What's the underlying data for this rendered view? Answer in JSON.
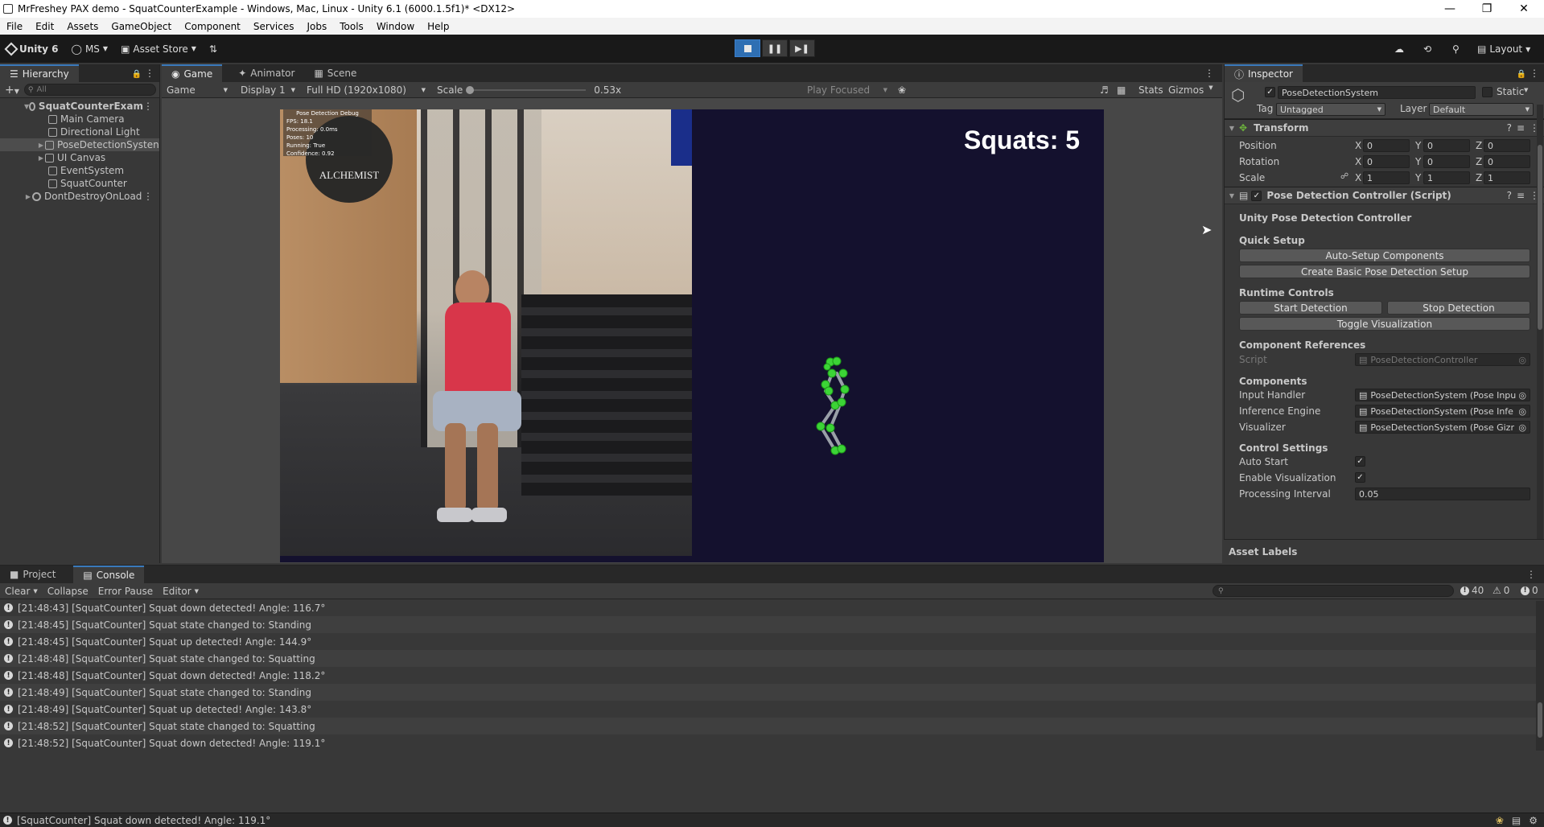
{
  "window": {
    "title": "MrFreshey PAX demo - SquatCounterExample - Windows, Mac, Linux - Unity 6.1 (6000.1.5f1)* <DX12>"
  },
  "menu": [
    "File",
    "Edit",
    "Assets",
    "GameObject",
    "Component",
    "Services",
    "Jobs",
    "Tools",
    "Window",
    "Help"
  ],
  "toolbar": {
    "unity_label": "Unity 6",
    "account_label": "MS",
    "asset_store_label": "Asset Store",
    "layout_label": "Layout"
  },
  "hierarchy": {
    "tab_label": "Hierarchy",
    "search_placeholder": "All",
    "items": [
      {
        "label": "SquatCounterExam",
        "level": 0
      },
      {
        "label": "Main Camera",
        "level": 1
      },
      {
        "label": "Directional Light",
        "level": 1
      },
      {
        "label": "PoseDetectionSysten",
        "level": 1
      },
      {
        "label": "UI Canvas",
        "level": 1
      },
      {
        "label": "EventSystem",
        "level": 1
      },
      {
        "label": "SquatCounter",
        "level": 1
      },
      {
        "label": "DontDestroyOnLoad",
        "level": 0
      }
    ]
  },
  "game": {
    "tabs": [
      "Game",
      "Animator",
      "Scene"
    ],
    "display_mode": "Game",
    "display": "Display 1",
    "resolution": "Full HD (1920x1080)",
    "scale_label": "Scale",
    "scale_value": "0.53x",
    "play_mode": "Play Focused",
    "stats_label": "Stats",
    "gizmos_label": "Gizmos",
    "squats_text": "Squats: 5",
    "debug": {
      "title": "Pose Detection Debug",
      "lines": [
        "FPS: 18.1",
        "Processing: 0.0ms",
        "Poses: 10",
        "Running: True",
        "Confidence: 0.92"
      ]
    },
    "logo_text": "ALCHEMIST"
  },
  "inspector": {
    "tab_label": "Inspector",
    "object_name": "PoseDetectionSystem",
    "static_label": "Static",
    "tag_label": "Tag",
    "tag_value": "Untagged",
    "layer_label": "Layer",
    "layer_value": "Default",
    "transform": {
      "title": "Transform",
      "rows": [
        {
          "label": "Position",
          "x": "0",
          "y": "0",
          "z": "0"
        },
        {
          "label": "Rotation",
          "x": "0",
          "y": "0",
          "z": "0"
        },
        {
          "label": "Scale",
          "x": "1",
          "y": "1",
          "z": "1"
        }
      ]
    },
    "component": {
      "title": "Pose Detection Controller (Script)",
      "heading": "Unity Pose Detection Controller",
      "quick_setup": "Quick Setup",
      "btn_auto_setup": "Auto-Setup Components",
      "btn_create_basic": "Create Basic Pose Detection Setup",
      "runtime_controls": "Runtime Controls",
      "btn_start": "Start Detection",
      "btn_stop": "Stop Detection",
      "btn_toggle": "Toggle Visualization",
      "component_refs": "Component References",
      "script_label": "Script",
      "script_value": "PoseDetectionController",
      "components": "Components",
      "input_handler_label": "Input Handler",
      "input_handler_value": "PoseDetectionSystem (Pose Inpu",
      "inference_label": "Inference Engine",
      "inference_value": "PoseDetectionSystem (Pose Infe",
      "visualizer_label": "Visualizer",
      "visualizer_value": "PoseDetectionSystem (Pose Gizr",
      "control_settings": "Control Settings",
      "auto_start_label": "Auto Start",
      "enable_vis_label": "Enable Visualization",
      "proc_interval_label": "Processing Interval",
      "proc_interval_value": "0.05"
    },
    "asset_labels": "Asset Labels"
  },
  "console": {
    "tabs": [
      "Project",
      "Console"
    ],
    "clear_label": "Clear",
    "collapse_label": "Collapse",
    "error_pause_label": "Error Pause",
    "editor_label": "Editor",
    "count_info": "40",
    "count_warn": "0",
    "count_error": "0",
    "logs": [
      "[21:48:43] [SquatCounter] Squat down detected! Angle: 116.7°",
      "[21:48:45] [SquatCounter] Squat state changed to: Standing",
      "[21:48:45] [SquatCounter] Squat up detected! Angle: 144.9°",
      "[21:48:48] [SquatCounter] Squat state changed to: Squatting",
      "[21:48:48] [SquatCounter] Squat down detected! Angle: 118.2°",
      "[21:48:49] [SquatCounter] Squat state changed to: Standing",
      "[21:48:49] [SquatCounter] Squat up detected! Angle: 143.8°",
      "[21:48:52] [SquatCounter] Squat state changed to: Squatting",
      "[21:48:52] [SquatCounter] Squat down detected! Angle: 119.1°"
    ]
  },
  "statusbar": {
    "message": "[SquatCounter] Squat down detected! Angle: 119.1°"
  },
  "colors": {
    "accent": "#3a79bb",
    "game_bg": "#14112e",
    "joint": "#3cd436"
  }
}
